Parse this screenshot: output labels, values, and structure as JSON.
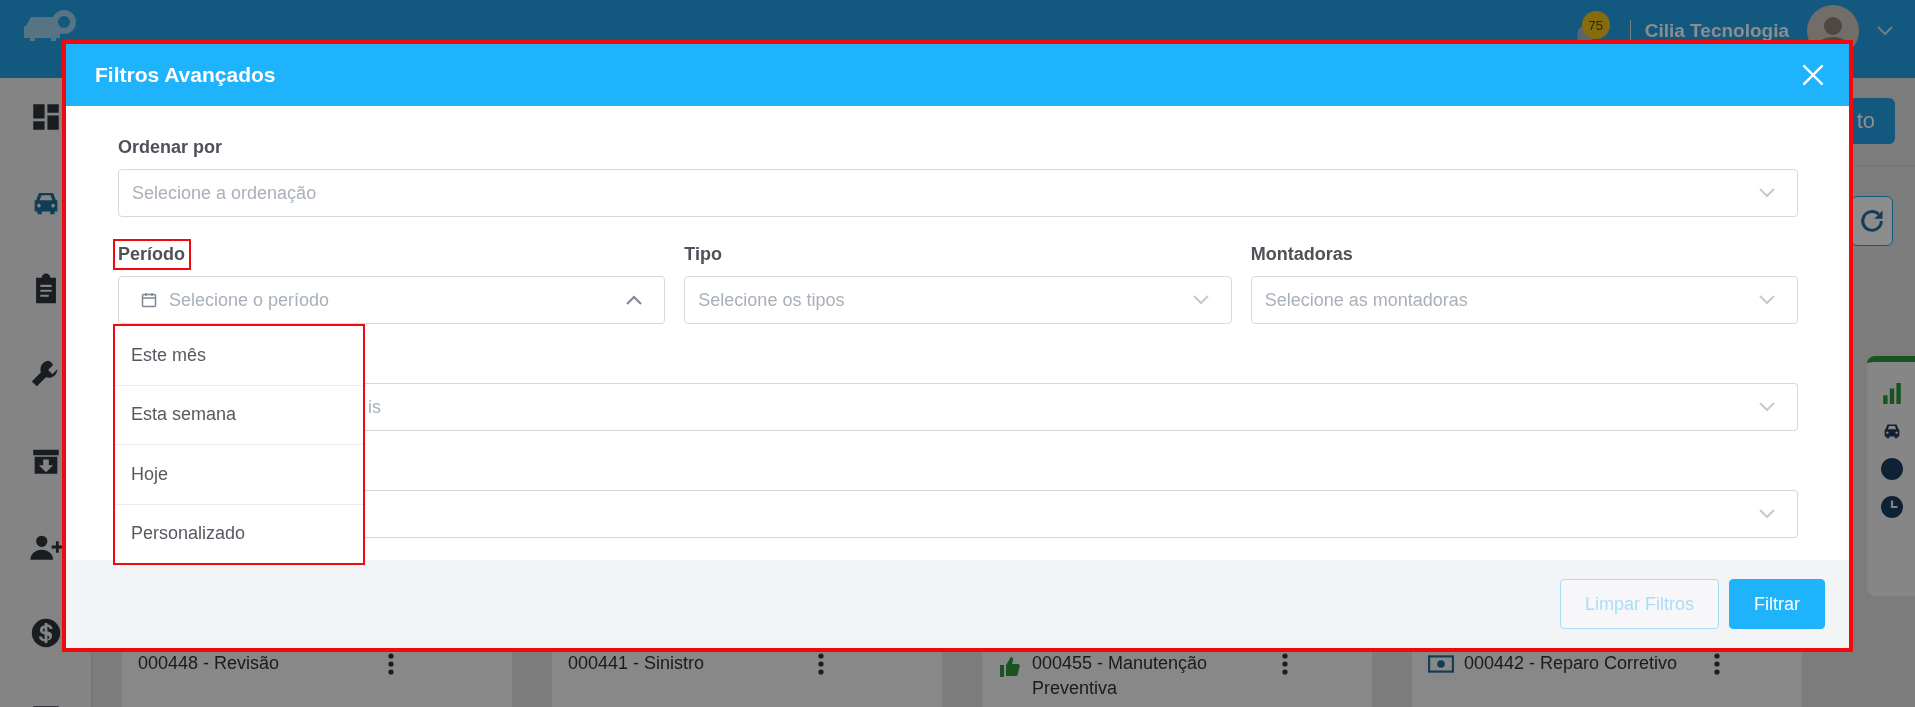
{
  "app_header": {
    "notification_count": "75",
    "company": "Cilia Tecnologia"
  },
  "sidebar": {
    "items": [
      {
        "kind": "dashboard",
        "selected": false
      },
      {
        "kind": "car",
        "selected": true
      },
      {
        "kind": "clipboard",
        "selected": false
      },
      {
        "kind": "wrench",
        "selected": false
      },
      {
        "kind": "archive",
        "selected": false
      },
      {
        "kind": "user-plus",
        "selected": false
      },
      {
        "kind": "dollar",
        "selected": false
      }
    ]
  },
  "toolbar": {
    "button": "to"
  },
  "cards": [
    {
      "title": "000448 - Revisão",
      "kind": "plain"
    },
    {
      "title": "000441 - Sinistro",
      "kind": "plain"
    },
    {
      "title": "000455 - Manutenção Preventiva",
      "kind": "approved"
    },
    {
      "title": "000442 - Reparo Corretivo",
      "kind": "cash"
    }
  ],
  "modal": {
    "title": "Filtros Avançados",
    "highlighted": true,
    "rows": [
      [
        {
          "kind": "select",
          "label": "Ordenar por",
          "placeholder": "Selecione a ordenação",
          "open": false
        }
      ],
      [
        {
          "kind": "date",
          "label": "Período",
          "placeholder": "Selecione o período",
          "open": true,
          "highlighted": true
        },
        {
          "kind": "select",
          "label": "Tipo",
          "placeholder": "Selecione os tipos",
          "open": false
        },
        {
          "kind": "select",
          "label": "Montadoras",
          "placeholder": "Selecione as montadoras",
          "open": false
        }
      ],
      [
        {
          "kind": "select",
          "placeholder": "is",
          "open": false
        }
      ],
      [
        {
          "kind": "select",
          "open": false
        }
      ]
    ],
    "dropdown": {
      "highlighted": true,
      "options": [
        "Este mês",
        "Esta semana",
        "Hoje",
        "Personalizado"
      ]
    },
    "buttons": [
      {
        "label": "Limpar Filtros",
        "disabled": true
      },
      {
        "label": "Filtrar",
        "disabled": false
      }
    ]
  }
}
